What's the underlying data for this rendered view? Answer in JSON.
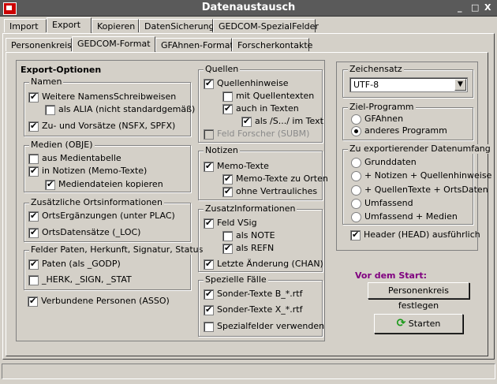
{
  "window": {
    "title": "Datenaustausch"
  },
  "title_buttons": {
    "minimize": "_",
    "maximize": "□",
    "close": "X"
  },
  "main_tabs": [
    "Import",
    "Export",
    "Kopieren",
    "DatenSicherung",
    "GEDCOM-SpezialFelder"
  ],
  "sub_tabs": [
    "Personenkreis",
    "GEDCOM-Format",
    "GFAhnen-Format",
    "Forscherkontakte"
  ],
  "export": {
    "heading": "Export-Optionen",
    "namen": {
      "title": "Namen",
      "weitere": "Weitere NamensSchreibweisen",
      "alia": "als ALIA (nicht standardgemäß)",
      "zu_vor": "Zu- und Vorsätze (NSFX, SPFX)"
    },
    "medien": {
      "title": "Medien (OBJE)",
      "aus_tabelle": "aus Medientabelle",
      "in_notizen": "in Notizen (Memo-Texte)",
      "kopieren": "Mediendateien kopieren"
    },
    "orts": {
      "title": "Zusätzliche Ortsinformationen",
      "ergaenzungen": "OrtsErgänzungen (unter PLAC)",
      "datensaetze": "OrtsDatensätze (_LOC)"
    },
    "felder": {
      "title": "Felder Paten, Herkunft, Signatur, Status",
      "paten": "Paten (als _GODP)",
      "herk": "_HERK, _SIGN, _STAT"
    },
    "verbundene": "Verbundene Personen (ASSO)"
  },
  "quellen": {
    "title": "Quellen",
    "hinweise": "Quellenhinweise",
    "mit_texten": "mit Quellentexten",
    "auch_texten": "auch in Texten",
    "als_s": "als /S.../ im Text",
    "forscher": "Feld Forscher (SUBM)"
  },
  "notizen": {
    "title": "Notizen",
    "memo": "Memo-Texte",
    "zu_orten": "Memo-Texte zu Orten",
    "ohne_vertr": "ohne Vertrauliches"
  },
  "zusatz": {
    "title": "ZusatzInformationen",
    "vsig": "Feld VSig",
    "note": "als NOTE",
    "refn": "als REFN",
    "letzte": "Letzte Änderung (CHAN)"
  },
  "spezielle": {
    "title": "Spezielle Fälle",
    "b": "Sonder-Texte B_*.rtf",
    "x": "Sonder-Texte X_*.rtf",
    "spezial": "Spezialfelder verwenden"
  },
  "zeichensatz": {
    "title": "Zeichensatz",
    "value": "UTF-8"
  },
  "zielprogramm": {
    "title": "Ziel-Programm",
    "options": [
      "GFAhnen",
      "anderes Programm"
    ],
    "selected": "anderes Programm"
  },
  "umfang": {
    "title": "Zu exportierender Datenumfang",
    "options": [
      "Grunddaten",
      "+ Notizen + Quellenhinweise",
      "+ QuellenTexte + OrtsDaten",
      "Umfassend",
      "Umfassend + Medien"
    ],
    "header": "Header (HEAD) ausführlich"
  },
  "start": {
    "label": "Vor dem Start:",
    "personenkreis_button": "Personenkreis festlegen",
    "starten_button": "Starten"
  }
}
